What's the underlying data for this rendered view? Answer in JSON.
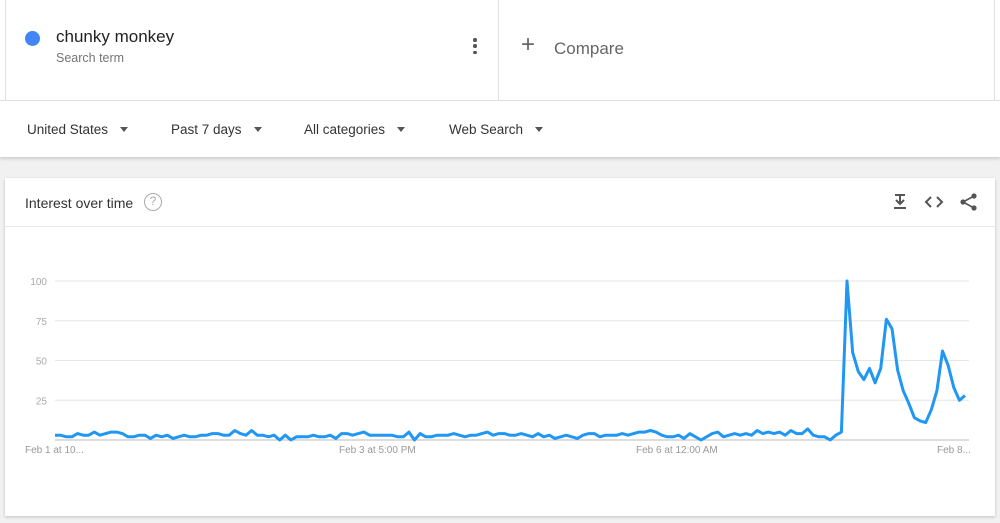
{
  "term": {
    "name": "chunky monkey",
    "subtitle": "Search term",
    "color": "#4285f4"
  },
  "compare": {
    "label": "Compare"
  },
  "filters": [
    {
      "label": "United States"
    },
    {
      "label": "Past 7 days"
    },
    {
      "label": "All categories"
    },
    {
      "label": "Web Search"
    }
  ],
  "card": {
    "title": "Interest over time",
    "help": "?",
    "icons": [
      "download-icon",
      "embed-icon",
      "share-icon"
    ]
  },
  "chart_data": {
    "type": "line",
    "title": "",
    "xlabel": "",
    "ylabel": "",
    "ylim": [
      0,
      100
    ],
    "y_ticks": [
      "25",
      "50",
      "75",
      "100"
    ],
    "x_tick_labels": [
      "Feb 1 at 10...",
      "Feb 3 at 5:00 PM",
      "Feb 6 at 12:00 AM",
      "Feb 8..."
    ],
    "grid": true,
    "line_color": "#2196f3",
    "series": [
      {
        "values": [
          3,
          3,
          2,
          2,
          4,
          3,
          3,
          5,
          3,
          4,
          5,
          5,
          4,
          2,
          2,
          3,
          3,
          1,
          3,
          2,
          3,
          1,
          2,
          3,
          2,
          2,
          3,
          3,
          4,
          4,
          3,
          3,
          6,
          4,
          3,
          6,
          3,
          3,
          2,
          3,
          0,
          3,
          0,
          2,
          2,
          2,
          3,
          2,
          2,
          3,
          1,
          4,
          4,
          3,
          4,
          5,
          3,
          3,
          3,
          3,
          3,
          2,
          2,
          5,
          0,
          4,
          2,
          2,
          3,
          3,
          3,
          4,
          3,
          2,
          3,
          3,
          4,
          5,
          3,
          4,
          4,
          3,
          3,
          4,
          3,
          2,
          4,
          2,
          3,
          1,
          2,
          3,
          2,
          1,
          3,
          4,
          4,
          2,
          3,
          3,
          3,
          4,
          3,
          4,
          5,
          5,
          6,
          5,
          3,
          2,
          2,
          3,
          1,
          4,
          2,
          0,
          2,
          4,
          5,
          2,
          3,
          4,
          3,
          4,
          3,
          6,
          4,
          5,
          4,
          5,
          3,
          6,
          4,
          4,
          7,
          3,
          2,
          2,
          0,
          3,
          5,
          100,
          55,
          43,
          38,
          45,
          36,
          45,
          76,
          70,
          44,
          31,
          23,
          14,
          12,
          11,
          19,
          31,
          56,
          47,
          33,
          25,
          28
        ]
      }
    ]
  }
}
